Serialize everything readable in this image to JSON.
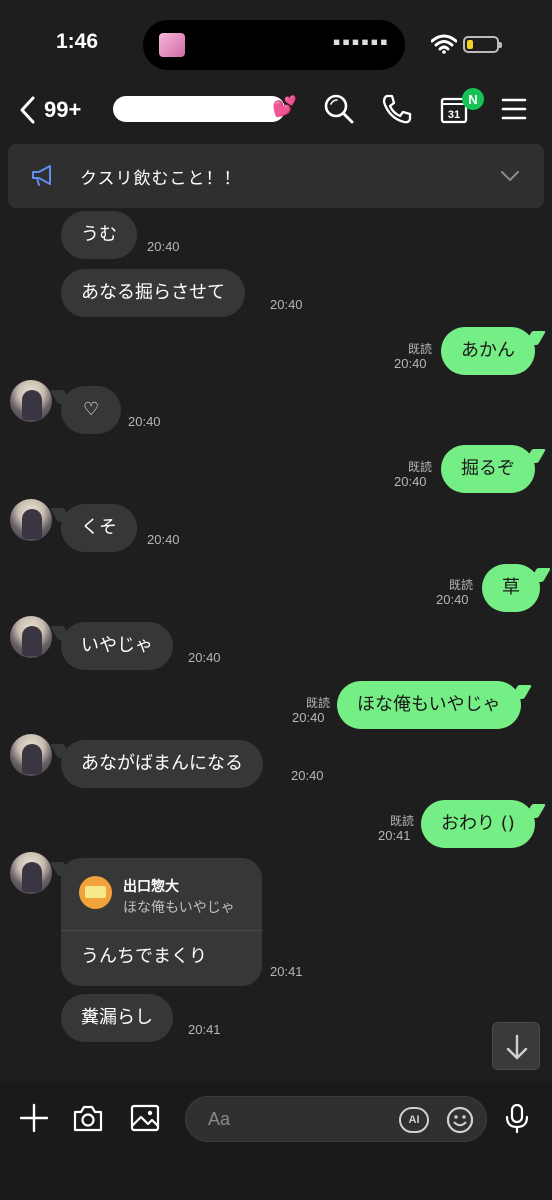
{
  "status": {
    "time": "1:46"
  },
  "header": {
    "back_count": "99+",
    "calendar_day": "31",
    "new_badge": "N"
  },
  "announcement": {
    "text": "クスリ飲むこと！！"
  },
  "messages": [
    {
      "side": "in",
      "text": "うむ",
      "time": "20:40"
    },
    {
      "side": "in",
      "text": "あなる掘らさせて",
      "time": "20:40"
    },
    {
      "side": "out",
      "text": "あかん",
      "time": "20:40",
      "read": "既読"
    },
    {
      "side": "in",
      "text": "♡",
      "time": "20:40"
    },
    {
      "side": "out",
      "text": "掘るぞ",
      "time": "20:40",
      "read": "既読"
    },
    {
      "side": "in",
      "text": "くそ",
      "time": "20:40"
    },
    {
      "side": "out",
      "text": "草",
      "time": "20:40",
      "read": "既読"
    },
    {
      "side": "in",
      "text": "いやじゃ",
      "time": "20:40"
    },
    {
      "side": "out",
      "text": "ほな俺もいやじゃ",
      "time": "20:40",
      "read": "既読"
    },
    {
      "side": "in",
      "text": "あながばまんになる",
      "time": "20:40"
    },
    {
      "side": "out",
      "text": "おわり ()",
      "time": "20:41",
      "read": "既読"
    },
    {
      "side": "in",
      "text": "うんちでまくり",
      "time": "20:41",
      "reply_to_name": "出口惣大",
      "reply_to_text": "ほな俺もいやじゃ"
    },
    {
      "side": "in",
      "text": "糞漏らし",
      "time": "20:41"
    }
  ],
  "input": {
    "placeholder": "Aa",
    "ai_label": "AI"
  },
  "colors": {
    "outgoing_bubble": "#76ee86",
    "incoming_bubble": "#373737",
    "background": "#1e1e1e",
    "badge": "#17c257"
  }
}
